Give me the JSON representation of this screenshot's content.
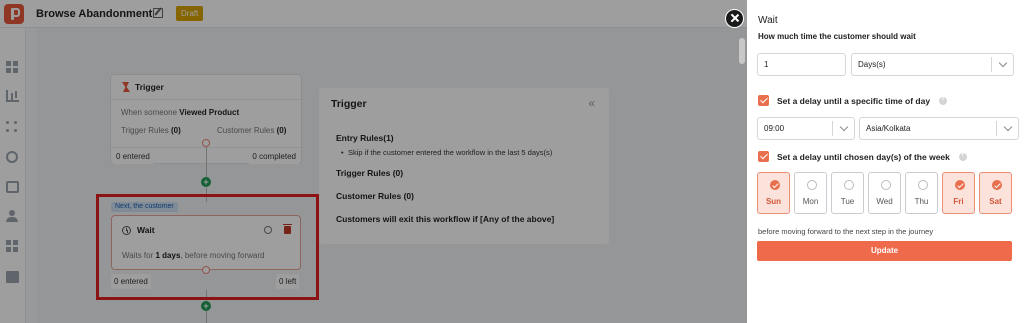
{
  "app": {
    "title": "Browse Abandonment",
    "status_badge": "Draft"
  },
  "trigger_node": {
    "title": "Trigger",
    "event_prefix": "When someone",
    "event": "Viewed Product",
    "trigger_rules_label": "Trigger Rules",
    "trigger_rules_count": "(0)",
    "customer_rules_label": "Customer Rules",
    "customer_rules_count": "(0)",
    "entered": "0 entered",
    "completed": "0 completed"
  },
  "next_tag": "Next, the customer",
  "wait_node": {
    "title": "Wait",
    "desc_prefix": "Waits for",
    "desc_value": "1 days",
    "desc_suffix": ", before moving forward",
    "entered": "0 entered",
    "left": "0 left"
  },
  "trigger_panel": {
    "title": "Trigger",
    "collapse_glyph": "«",
    "entry_rules": "Entry Rules(1)",
    "entry_bullet": "Skip if the customer entered the workflow in the last 5 days(s)",
    "trigger_rules": "Trigger Rules",
    "trigger_rules_count": "(0)",
    "customer_rules": "Customer Rules",
    "customer_rules_count": "(0)",
    "exit_text": "Customers will exit this workflow if [Any of the above]"
  },
  "drawer": {
    "title": "Wait",
    "subtitle": "How much time the customer should wait",
    "duration_value": "1",
    "duration_unit": "Days(s)",
    "time_checkbox_label": "Set a delay until a specific time of day",
    "time_value": "09:00",
    "timezone_value": "Asia/Kolkata",
    "days_checkbox_label": "Set a delay until chosen day(s) of the week",
    "days": [
      {
        "label": "Sun",
        "selected": true
      },
      {
        "label": "Mon",
        "selected": false
      },
      {
        "label": "Tue",
        "selected": false
      },
      {
        "label": "Wed",
        "selected": false
      },
      {
        "label": "Thu",
        "selected": false
      },
      {
        "label": "Fri",
        "selected": true
      },
      {
        "label": "Sat",
        "selected": true
      }
    ],
    "note": "before moving forward to the next step in the journey",
    "update_label": "Update"
  },
  "colors": {
    "accent": "#ef6a4a",
    "highlight": "#e21f1f",
    "add": "#1f9d55",
    "draft": "#d9a300"
  }
}
